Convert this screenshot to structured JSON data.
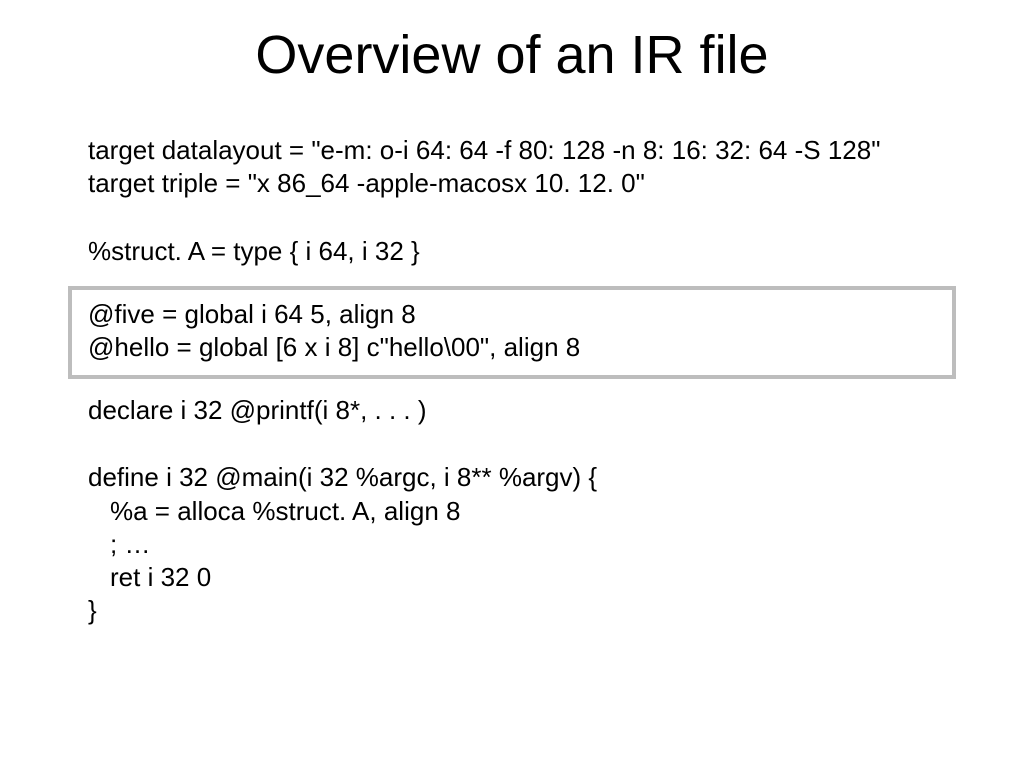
{
  "title": "Overview of an IR file",
  "code": {
    "datalayout": "target datalayout = \"e-m: o-i 64: 64 -f 80: 128 -n 8: 16: 32: 64 -S 128\"",
    "triple": "target triple = \"x 86_64 -apple-macosx 10. 12. 0\"",
    "struct": "%struct. A = type { i 64, i 32 }",
    "five": "@five = global i 64 5, align 8",
    "hello": "@hello = global [6 x i 8] c\"hello\\00\", align 8",
    "declare": "declare i 32 @printf(i 8*, . . . )",
    "define": "define i 32 @main(i 32 %argc, i 8** %argv) {",
    "alloca": "%a = alloca %struct. A, align 8",
    "dots": "; …",
    "ret": "ret i 32 0",
    "close": "}"
  }
}
